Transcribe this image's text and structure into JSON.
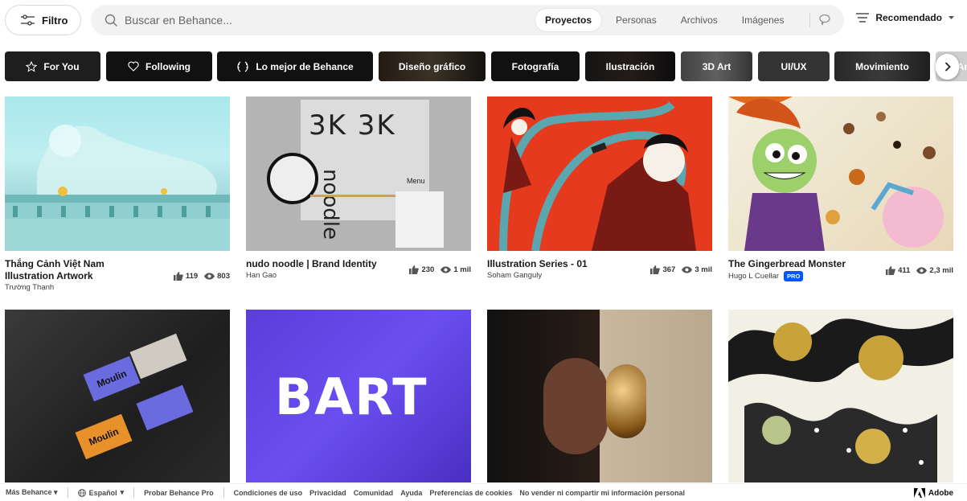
{
  "header": {
    "filter_label": "Filtro",
    "search_placeholder": "Buscar en Behance...",
    "search_tabs": [
      "Proyectos",
      "Personas",
      "Archivos",
      "Imágenes"
    ],
    "active_tab": "Proyectos",
    "sort_label": "Recomendado"
  },
  "categories": [
    {
      "label": "For You",
      "icon": "star-icon"
    },
    {
      "label": "Following",
      "icon": "heart-icon"
    },
    {
      "label": "Lo mejor de Behance",
      "icon": "laurel-icon"
    },
    {
      "label": "Diseño gráfico"
    },
    {
      "label": "Fotografía"
    },
    {
      "label": "Ilustración"
    },
    {
      "label": "3D Art"
    },
    {
      "label": "UI/UX"
    },
    {
      "label": "Movimiento"
    },
    {
      "label": "Ar"
    }
  ],
  "projects": [
    {
      "title": "Thắng Cảnh Việt Nam Illustration Artwork",
      "owner": "Trường Thạnh",
      "likes": "119",
      "views": "803",
      "pro": false
    },
    {
      "title": "nudo noodle | Brand Identity",
      "owner": "Han Gao",
      "likes": "230",
      "views": "1 mil",
      "pro": false
    },
    {
      "title": "Illustration Series - 01",
      "owner": "Soham Ganguly",
      "likes": "367",
      "views": "3 mil",
      "pro": false
    },
    {
      "title": "The Gingerbread Monster",
      "owner": "Hugo L Cuellar",
      "likes": "411",
      "views": "2,3 mil",
      "pro": true
    },
    {
      "title": "",
      "owner": "",
      "likes": "",
      "views": "",
      "pro": false
    },
    {
      "title": "",
      "owner": "",
      "likes": "",
      "views": "",
      "pro": false
    },
    {
      "title": "",
      "owner": "",
      "likes": "",
      "views": "",
      "pro": false
    },
    {
      "title": "",
      "owner": "",
      "likes": "",
      "views": "",
      "pro": false
    }
  ],
  "thumb_text": {
    "noodle_brand": "3K 3K",
    "noodle_word": "noodle",
    "noodle_menu": "Menu",
    "moulin": "Moulin",
    "bart": "BART"
  },
  "pro_badge": "PRO",
  "footer": {
    "more": "Más Behance",
    "language": "Español",
    "try_pro": "Probar Behance Pro",
    "links": [
      "Condiciones de uso",
      "Privacidad",
      "Comunidad",
      "Ayuda",
      "Preferencias de cookies",
      "No vender ni compartir mi información personal"
    ],
    "adobe": "Adobe"
  },
  "colors": {
    "accent": "#0057ff",
    "chip_dark": "#111111"
  }
}
